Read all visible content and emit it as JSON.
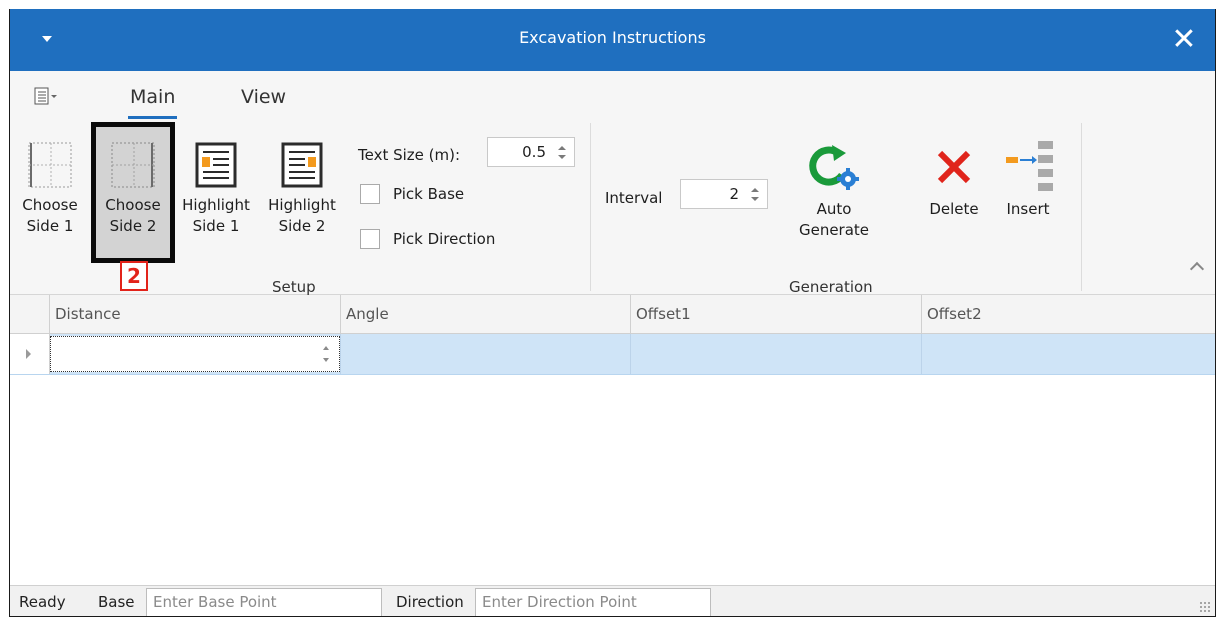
{
  "window": {
    "title": "Excavation Instructions"
  },
  "ribbon": {
    "tabs": [
      {
        "label": "Main",
        "active": true
      },
      {
        "label": "View",
        "active": false
      }
    ],
    "setup": {
      "group_label": "Setup",
      "buttons": [
        {
          "line1": "Choose",
          "line2": "Side 1"
        },
        {
          "line1": "Choose",
          "line2": "Side 2",
          "selected": true
        },
        {
          "line1": "Highlight",
          "line2": "Side 1"
        },
        {
          "line1": "Highlight",
          "line2": "Side 2"
        }
      ],
      "text_size_label": "Text Size (m):",
      "text_size_value": "0.5",
      "pick_base_label": "Pick Base",
      "pick_direction_label": "Pick Direction"
    },
    "generation": {
      "group_label": "Generation",
      "interval_label": "Interval",
      "interval_value": "2",
      "auto_generate_label": "Auto Generate",
      "delete_label": "Delete",
      "insert_label": "Insert"
    }
  },
  "annotation": {
    "marker": "2"
  },
  "grid": {
    "columns": [
      "Distance",
      "Angle",
      "Offset1",
      "Offset2"
    ],
    "rows": [
      {
        "Distance": "",
        "Angle": "",
        "Offset1": "",
        "Offset2": ""
      }
    ]
  },
  "statusbar": {
    "status": "Ready",
    "base_label": "Base",
    "base_placeholder": "Enter Base Point",
    "direction_label": "Direction",
    "direction_placeholder": "Enter Direction Point"
  },
  "colors": {
    "title_bar": "#1f6fbf",
    "selection_row": "#cfe4f7",
    "marker": "#e2231a",
    "delete_icon": "#e0241b",
    "refresh_icon": "#1a9a3a",
    "gear_icon": "#2a7fd4"
  },
  "icons": [
    "dropdown-arrow-icon",
    "close-icon",
    "quick-access-menu-icon",
    "choose-side-1-icon",
    "choose-side-2-icon",
    "highlight-side-1-icon",
    "highlight-side-2-icon",
    "auto-generate-icon",
    "delete-icon",
    "insert-icon",
    "collapse-ribbon-icon",
    "row-indicator-icon",
    "resize-grip-icon"
  ]
}
